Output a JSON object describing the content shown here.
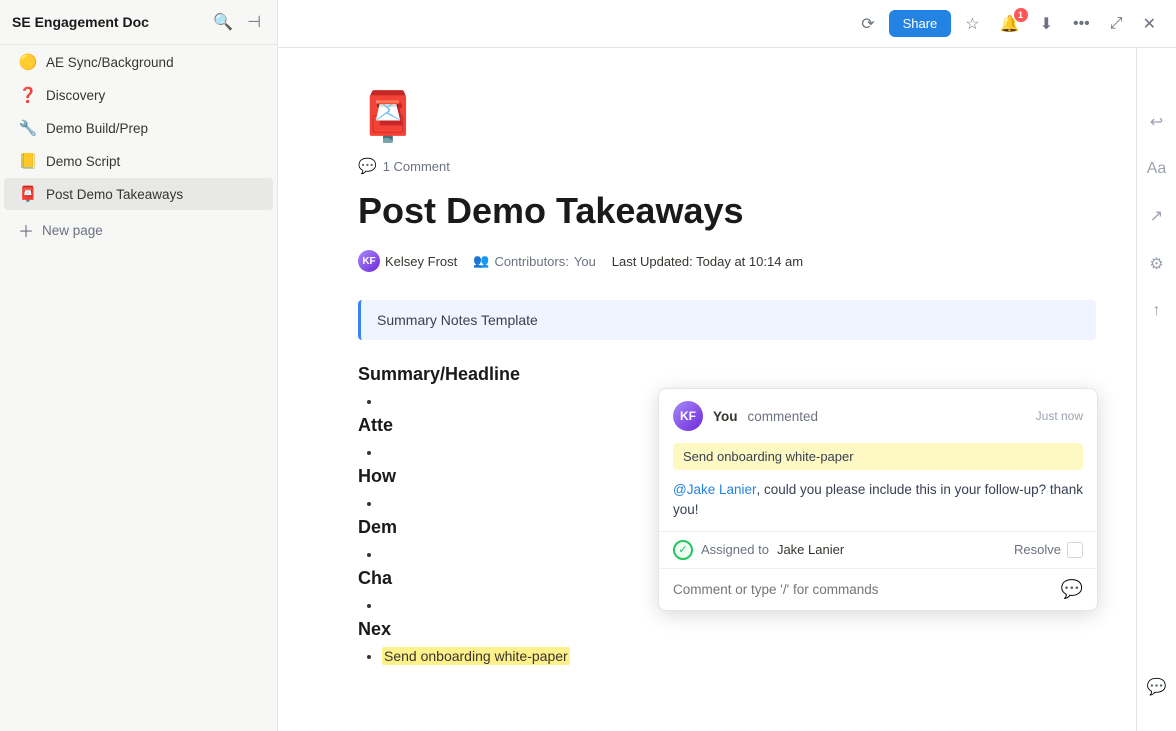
{
  "sidebar": {
    "title": "SE Engagement Doc",
    "items": [
      {
        "id": "ae-sync",
        "icon": "🟡",
        "label": "AE Sync/Background"
      },
      {
        "id": "discovery",
        "icon": "❓",
        "label": "Discovery"
      },
      {
        "id": "demo-build-prep",
        "icon": "🔧",
        "label": "Demo Build/Prep"
      },
      {
        "id": "demo-script",
        "icon": "📒",
        "label": "Demo Script"
      },
      {
        "id": "post-demo",
        "icon": "📮",
        "label": "Post Demo Takeaways",
        "active": true
      }
    ],
    "new_page_label": "New page"
  },
  "topbar": {
    "share_label": "Share",
    "notif_count": "1"
  },
  "page": {
    "icon": "📮",
    "comment_count": "1 Comment",
    "title": "Post Demo Takeaways",
    "author": "Kelsey Frost",
    "contributors_label": "Contributors:",
    "contributors_value": "You",
    "updated_label": "Last Updated:",
    "updated_value": "Today at 10:14 am",
    "template_text": "Summary Notes Template",
    "section1": "Summary/Headline",
    "section2_prefix": "Atte",
    "section3_prefix": "How",
    "section4_prefix": "Dem",
    "section5_prefix": "Cha",
    "section6_prefix": "Nex",
    "highlighted_bullet": "Send onboarding white-paper"
  },
  "comment": {
    "author": "You",
    "verb": "commented",
    "time": "Just now",
    "highlighted_text": "Send onboarding white-paper",
    "body_mention": "@Jake Lanier",
    "body_text": ", could you please include this in your follow-up? thank you!",
    "assigned_label": "Assigned to",
    "assignee": "Jake Lanier",
    "resolve_label": "Resolve",
    "input_placeholder": "Comment or type '/' for commands"
  }
}
